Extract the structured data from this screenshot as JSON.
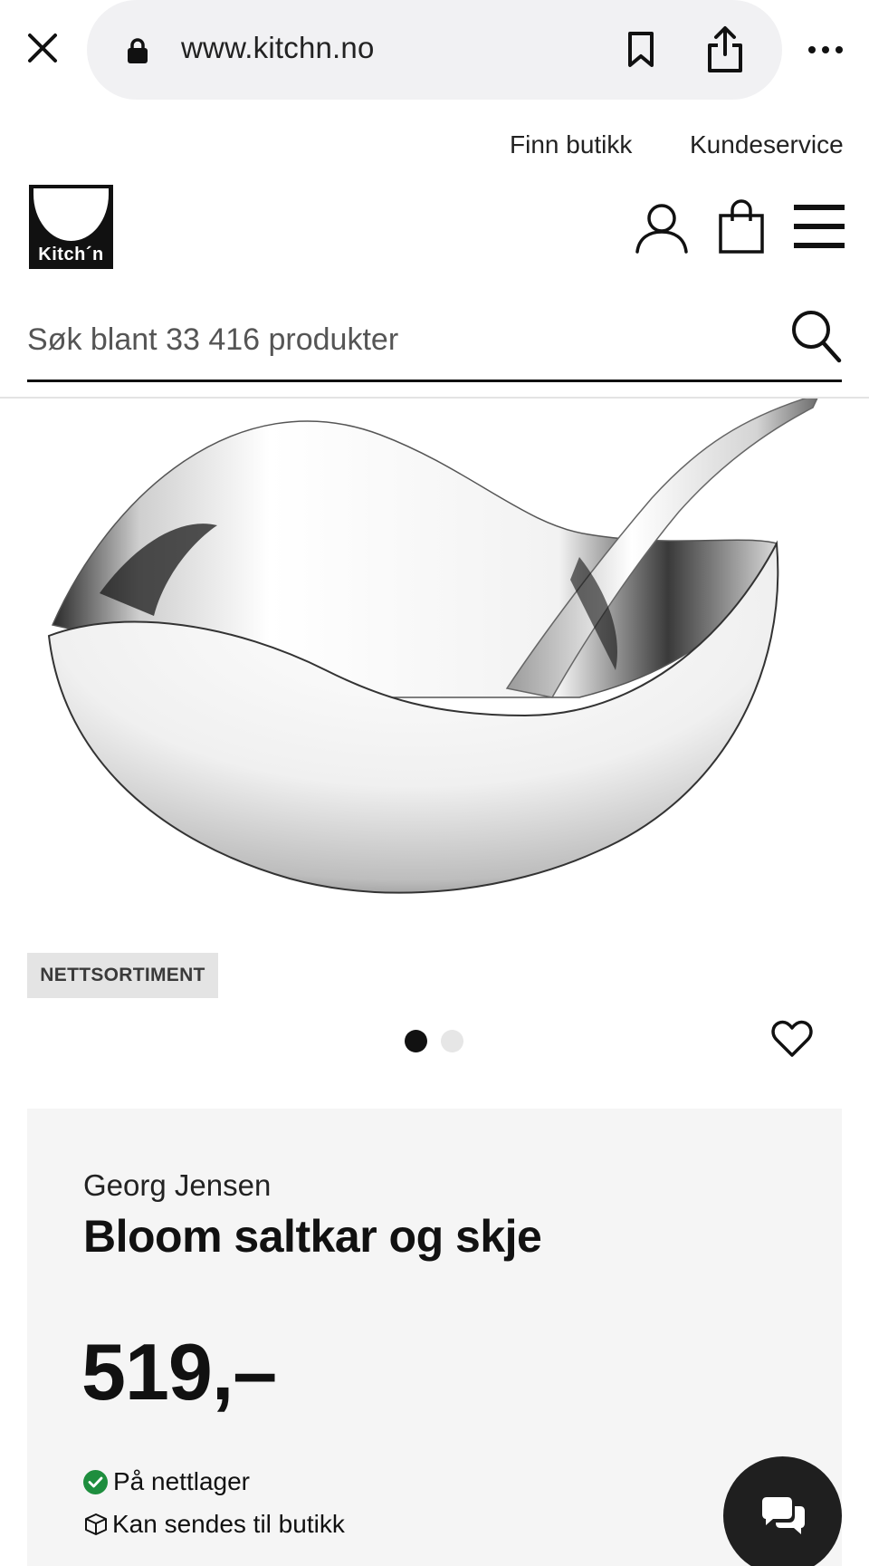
{
  "browser": {
    "url": "www.kitchn.no"
  },
  "top_links": {
    "find_store": "Finn butikk",
    "customer_service": "Kundeservice"
  },
  "header": {
    "logo_text": "Kitch´n"
  },
  "search": {
    "placeholder": "Søk blant 33 416 produkter"
  },
  "product": {
    "badge": "NETTSORTIMENT",
    "brand": "Georg Jensen",
    "name": "Bloom saltkar og skje",
    "price": "519,–",
    "carousel_total": 2,
    "carousel_active": 1,
    "availability": [
      {
        "icon": "check-icon",
        "text": "På nettlager"
      },
      {
        "icon": "box-icon",
        "text": "Kan sendes til butikk"
      }
    ]
  },
  "colors": {
    "accent": "#111111",
    "in_stock_green": "#1e8e3e",
    "panel_bg": "#f5f5f5",
    "badge_bg": "#e4e4e4"
  }
}
